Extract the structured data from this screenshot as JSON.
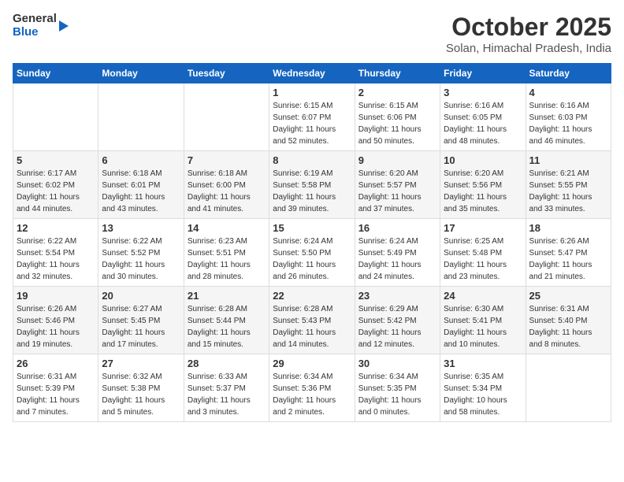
{
  "header": {
    "logo_general": "General",
    "logo_blue": "Blue",
    "month_title": "October 2025",
    "subtitle": "Solan, Himachal Pradesh, India"
  },
  "weekdays": [
    "Sunday",
    "Monday",
    "Tuesday",
    "Wednesday",
    "Thursday",
    "Friday",
    "Saturday"
  ],
  "weeks": [
    [
      {
        "day": "",
        "info": ""
      },
      {
        "day": "",
        "info": ""
      },
      {
        "day": "",
        "info": ""
      },
      {
        "day": "1",
        "info": "Sunrise: 6:15 AM\nSunset: 6:07 PM\nDaylight: 11 hours\nand 52 minutes."
      },
      {
        "day": "2",
        "info": "Sunrise: 6:15 AM\nSunset: 6:06 PM\nDaylight: 11 hours\nand 50 minutes."
      },
      {
        "day": "3",
        "info": "Sunrise: 6:16 AM\nSunset: 6:05 PM\nDaylight: 11 hours\nand 48 minutes."
      },
      {
        "day": "4",
        "info": "Sunrise: 6:16 AM\nSunset: 6:03 PM\nDaylight: 11 hours\nand 46 minutes."
      }
    ],
    [
      {
        "day": "5",
        "info": "Sunrise: 6:17 AM\nSunset: 6:02 PM\nDaylight: 11 hours\nand 44 minutes."
      },
      {
        "day": "6",
        "info": "Sunrise: 6:18 AM\nSunset: 6:01 PM\nDaylight: 11 hours\nand 43 minutes."
      },
      {
        "day": "7",
        "info": "Sunrise: 6:18 AM\nSunset: 6:00 PM\nDaylight: 11 hours\nand 41 minutes."
      },
      {
        "day": "8",
        "info": "Sunrise: 6:19 AM\nSunset: 5:58 PM\nDaylight: 11 hours\nand 39 minutes."
      },
      {
        "day": "9",
        "info": "Sunrise: 6:20 AM\nSunset: 5:57 PM\nDaylight: 11 hours\nand 37 minutes."
      },
      {
        "day": "10",
        "info": "Sunrise: 6:20 AM\nSunset: 5:56 PM\nDaylight: 11 hours\nand 35 minutes."
      },
      {
        "day": "11",
        "info": "Sunrise: 6:21 AM\nSunset: 5:55 PM\nDaylight: 11 hours\nand 33 minutes."
      }
    ],
    [
      {
        "day": "12",
        "info": "Sunrise: 6:22 AM\nSunset: 5:54 PM\nDaylight: 11 hours\nand 32 minutes."
      },
      {
        "day": "13",
        "info": "Sunrise: 6:22 AM\nSunset: 5:52 PM\nDaylight: 11 hours\nand 30 minutes."
      },
      {
        "day": "14",
        "info": "Sunrise: 6:23 AM\nSunset: 5:51 PM\nDaylight: 11 hours\nand 28 minutes."
      },
      {
        "day": "15",
        "info": "Sunrise: 6:24 AM\nSunset: 5:50 PM\nDaylight: 11 hours\nand 26 minutes."
      },
      {
        "day": "16",
        "info": "Sunrise: 6:24 AM\nSunset: 5:49 PM\nDaylight: 11 hours\nand 24 minutes."
      },
      {
        "day": "17",
        "info": "Sunrise: 6:25 AM\nSunset: 5:48 PM\nDaylight: 11 hours\nand 23 minutes."
      },
      {
        "day": "18",
        "info": "Sunrise: 6:26 AM\nSunset: 5:47 PM\nDaylight: 11 hours\nand 21 minutes."
      }
    ],
    [
      {
        "day": "19",
        "info": "Sunrise: 6:26 AM\nSunset: 5:46 PM\nDaylight: 11 hours\nand 19 minutes."
      },
      {
        "day": "20",
        "info": "Sunrise: 6:27 AM\nSunset: 5:45 PM\nDaylight: 11 hours\nand 17 minutes."
      },
      {
        "day": "21",
        "info": "Sunrise: 6:28 AM\nSunset: 5:44 PM\nDaylight: 11 hours\nand 15 minutes."
      },
      {
        "day": "22",
        "info": "Sunrise: 6:28 AM\nSunset: 5:43 PM\nDaylight: 11 hours\nand 14 minutes."
      },
      {
        "day": "23",
        "info": "Sunrise: 6:29 AM\nSunset: 5:42 PM\nDaylight: 11 hours\nand 12 minutes."
      },
      {
        "day": "24",
        "info": "Sunrise: 6:30 AM\nSunset: 5:41 PM\nDaylight: 11 hours\nand 10 minutes."
      },
      {
        "day": "25",
        "info": "Sunrise: 6:31 AM\nSunset: 5:40 PM\nDaylight: 11 hours\nand 8 minutes."
      }
    ],
    [
      {
        "day": "26",
        "info": "Sunrise: 6:31 AM\nSunset: 5:39 PM\nDaylight: 11 hours\nand 7 minutes."
      },
      {
        "day": "27",
        "info": "Sunrise: 6:32 AM\nSunset: 5:38 PM\nDaylight: 11 hours\nand 5 minutes."
      },
      {
        "day": "28",
        "info": "Sunrise: 6:33 AM\nSunset: 5:37 PM\nDaylight: 11 hours\nand 3 minutes."
      },
      {
        "day": "29",
        "info": "Sunrise: 6:34 AM\nSunset: 5:36 PM\nDaylight: 11 hours\nand 2 minutes."
      },
      {
        "day": "30",
        "info": "Sunrise: 6:34 AM\nSunset: 5:35 PM\nDaylight: 11 hours\nand 0 minutes."
      },
      {
        "day": "31",
        "info": "Sunrise: 6:35 AM\nSunset: 5:34 PM\nDaylight: 10 hours\nand 58 minutes."
      },
      {
        "day": "",
        "info": ""
      }
    ]
  ]
}
